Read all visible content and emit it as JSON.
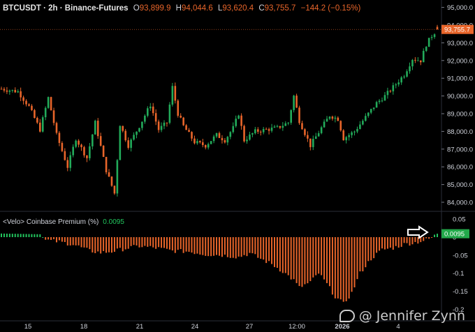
{
  "header": {
    "symbol": "BTCUSDT · 2h · Binance-Futures",
    "o_label": "O",
    "o_value": "93,899.9",
    "h_label": "H",
    "h_value": "94,044.6",
    "l_label": "L",
    "l_value": "93,620.4",
    "c_label": "C",
    "c_value": "93,755.7",
    "change": "−144.2 (−0.15%)"
  },
  "indicator": {
    "label": "<Velo> Coinbase Premium (%)",
    "value": "0.0095"
  },
  "watermark": "@ Jennifer Zynn",
  "colors": {
    "up": "#22ab5a",
    "down": "#e8652a",
    "premium_negative": "#e8652a",
    "premium_positive": "#22c55e",
    "price_tag": "#e8652a",
    "value_tag": "#22a84a"
  },
  "chart_data": [
    {
      "type": "candlestick",
      "x_tick_labels": [
        "15",
        "18",
        "21",
        "24",
        "27",
        "12:00",
        "2026",
        "4"
      ],
      "y_tick_labels": [
        "95,000.0",
        "94,000.0",
        "93,000.0",
        "92,000.0",
        "91,000.0",
        "90,000.0",
        "89,000.0",
        "88,000.0",
        "87,000.0",
        "86,000.0",
        "85,000.0",
        "84,000.0"
      ],
      "ylim": [
        83500,
        95200
      ],
      "last_price_label": "93,755.7",
      "close_path": [
        [
          0,
          90400
        ],
        [
          6,
          90250
        ],
        [
          10,
          89400
        ],
        [
          14,
          88100
        ],
        [
          17,
          89900
        ],
        [
          20,
          87800
        ],
        [
          24,
          86000
        ],
        [
          27,
          87600
        ],
        [
          31,
          86500
        ],
        [
          34,
          88500
        ],
        [
          38,
          85800
        ],
        [
          41,
          84500
        ],
        [
          43,
          88400
        ],
        [
          46,
          87200
        ],
        [
          50,
          88300
        ],
        [
          54,
          89500
        ],
        [
          57,
          88100
        ],
        [
          60,
          88500
        ],
        [
          62,
          90500
        ],
        [
          64,
          89000
        ],
        [
          66,
          88300
        ],
        [
          70,
          87400
        ],
        [
          74,
          87200
        ],
        [
          78,
          87800
        ],
        [
          81,
          87500
        ],
        [
          84,
          88200
        ],
        [
          86,
          89000
        ],
        [
          88,
          87500
        ],
        [
          92,
          88000
        ],
        [
          96,
          88100
        ],
        [
          100,
          88200
        ],
        [
          104,
          88500
        ],
        [
          106,
          90000
        ],
        [
          108,
          88600
        ],
        [
          112,
          87200
        ],
        [
          116,
          88200
        ],
        [
          119,
          88900
        ],
        [
          122,
          88700
        ],
        [
          124,
          87600
        ],
        [
          128,
          88000
        ],
        [
          132,
          88800
        ],
        [
          136,
          89600
        ],
        [
          139,
          90000
        ],
        [
          142,
          90500
        ],
        [
          146,
          91200
        ],
        [
          149,
          92100
        ],
        [
          152,
          92000
        ],
        [
          154,
          92900
        ],
        [
          156,
          93400
        ],
        [
          158,
          93755.7
        ]
      ]
    },
    {
      "type": "bar",
      "title": "<Velo> Coinbase Premium (%)",
      "y_tick_labels": [
        "0.05",
        "0",
        "-0.05",
        "-0.1",
        "-0.15",
        "-0.2"
      ],
      "ylim": [
        -0.2,
        0.05
      ],
      "last_value_label": "0.0095",
      "premium_path": [
        [
          0,
          0.01
        ],
        [
          14,
          0.008
        ],
        [
          16,
          -0.008
        ],
        [
          20,
          -0.012
        ],
        [
          26,
          -0.02
        ],
        [
          32,
          -0.038
        ],
        [
          36,
          -0.043
        ],
        [
          40,
          -0.04
        ],
        [
          46,
          -0.03
        ],
        [
          50,
          -0.025
        ],
        [
          56,
          -0.03
        ],
        [
          62,
          -0.038
        ],
        [
          68,
          -0.04
        ],
        [
          74,
          -0.048
        ],
        [
          80,
          -0.05
        ],
        [
          86,
          -0.055
        ],
        [
          90,
          -0.045
        ],
        [
          94,
          -0.06
        ],
        [
          98,
          -0.075
        ],
        [
          102,
          -0.095
        ],
        [
          106,
          -0.12
        ],
        [
          108,
          -0.14
        ],
        [
          112,
          -0.125
        ],
        [
          115,
          -0.1
        ],
        [
          118,
          -0.13
        ],
        [
          121,
          -0.165
        ],
        [
          124,
          -0.185
        ],
        [
          127,
          -0.155
        ],
        [
          130,
          -0.1
        ],
        [
          134,
          -0.06
        ],
        [
          138,
          -0.035
        ],
        [
          142,
          -0.03
        ],
        [
          146,
          -0.02
        ],
        [
          150,
          -0.015
        ],
        [
          154,
          -0.008
        ],
        [
          156,
          -0.002
        ],
        [
          158,
          0.0095
        ]
      ]
    }
  ]
}
